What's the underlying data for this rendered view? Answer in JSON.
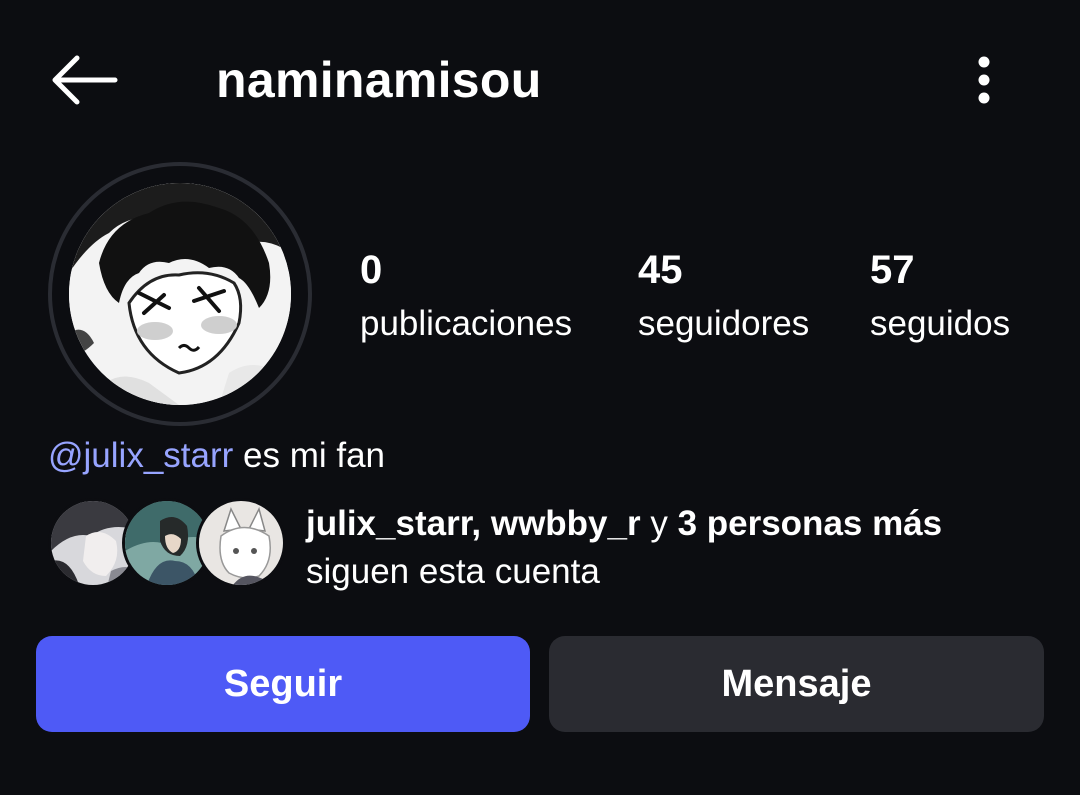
{
  "header": {
    "username": "naminamisou",
    "back_icon": "arrow-left-icon",
    "menu_icon": "more-vertical-icon"
  },
  "profile": {
    "avatar_icon": "profile-picture"
  },
  "stats": {
    "posts": {
      "count": "0",
      "label": "publicaciones"
    },
    "followers": {
      "count": "45",
      "label": "seguidores"
    },
    "following": {
      "count": "57",
      "label": "seguidos"
    }
  },
  "fan": {
    "mention": "@julix_starr",
    "text": " es mi fan"
  },
  "mutual": {
    "user1": "julix_starr",
    "separator": ", ",
    "user2": "wwbby_r",
    "conjunction": " y ",
    "more": "3 personas más",
    "line2": "siguen esta cuenta"
  },
  "buttons": {
    "follow": "Seguir",
    "message": "Mensaje"
  },
  "colors": {
    "background": "#0c0d11",
    "follow_button": "#4e5af6",
    "message_button": "#2a2b31",
    "mention": "#97a4ff"
  }
}
